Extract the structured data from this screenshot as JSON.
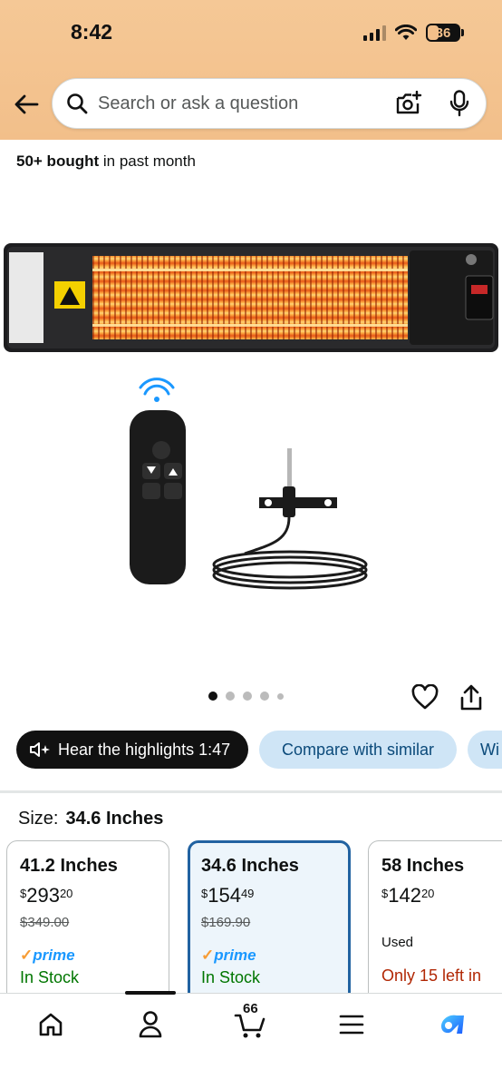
{
  "status_bar": {
    "time": "8:42",
    "battery": "36"
  },
  "search": {
    "placeholder": "Search or ask a question"
  },
  "social_proof": {
    "count": "50+ bought",
    "suffix": " in past month"
  },
  "product_image": {
    "icons": [
      "heater-image",
      "remote-control-image",
      "mounting-bracket-image"
    ]
  },
  "gallery": {
    "total_dots": 5,
    "active_index": 0
  },
  "chips": {
    "highlights": "Hear the highlights 1:47",
    "compare": "Compare with similar",
    "more": "Wi"
  },
  "size": {
    "label": "Size:",
    "value": "34.6 Inches"
  },
  "size_options": [
    {
      "title": "41.2 Inches",
      "price_symbol": "$",
      "price_whole": "293",
      "price_cents": "20",
      "list_price": "$349.00",
      "prime": "prime",
      "availability": "In Stock"
    },
    {
      "title": "34.6 Inches",
      "price_symbol": "$",
      "price_whole": "154",
      "price_cents": "49",
      "list_price": "$169.90",
      "prime": "prime",
      "availability": "In Stock"
    },
    {
      "title": "58 Inches",
      "price_symbol": "$",
      "price_whole": "142",
      "price_cents": "20",
      "condition": "Used",
      "availability": "Only 15 left in"
    }
  ],
  "tabbar": {
    "cart_count": "66"
  },
  "colors": {
    "header_bg": "#f2bf8a",
    "chip_dark": "#111111",
    "chip_light": "#cfe5f6",
    "selected_border": "#2162a1",
    "in_stock": "#007600",
    "low_stock": "#b12704",
    "prime_blue": "#1a98ff"
  }
}
